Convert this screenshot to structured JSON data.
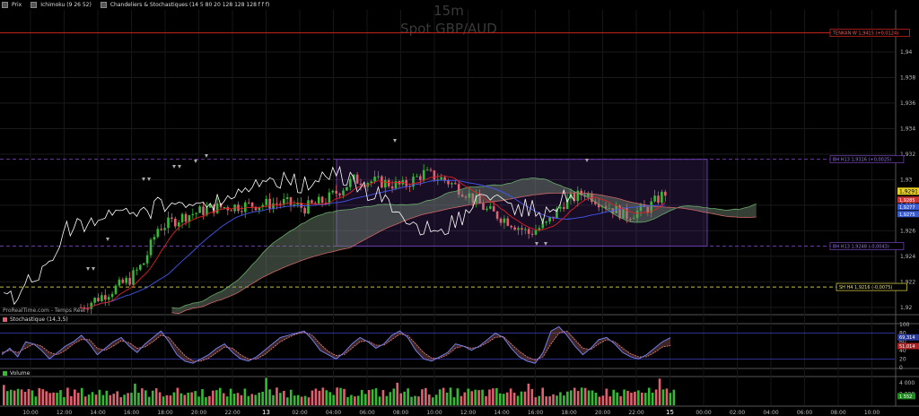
{
  "toolbar": {
    "items": [
      {
        "label": "Prix",
        "icon": "price-icon"
      },
      {
        "label": "Ichimoku (9 26 52)",
        "icon": "ichimoku-icon"
      },
      {
        "label": "Chandeliers & Stochastiques (14 5 80 20 128 128 128 f f f)",
        "icon": "candles-icon"
      }
    ]
  },
  "watermark": {
    "timeframe": "15m",
    "instrument": "Spot GBP/AUD"
  },
  "credit": "ProRealTime.com - Temps Réel",
  "price_axis": {
    "ticks": [
      "1,94",
      "1,938",
      "1,936",
      "1,934",
      "1,932",
      "1,93",
      "1,928",
      "1,926",
      "1,924",
      "1,922",
      "1,92"
    ],
    "current_price": "1,9291",
    "badges": [
      "1,9285",
      "1,9277",
      "1,9275"
    ]
  },
  "levels": [
    {
      "label": "TENKAN W 1,9415 (+0,0124)",
      "value": 1.9415,
      "color": "#cc2222"
    },
    {
      "label": "BH H13 1,9316 (+0,0025)",
      "value": 1.9316,
      "color": "#6a3aa8"
    },
    {
      "label": "BH H13 1,9248 (-0,0043)",
      "value": 1.9248,
      "color": "#6a3aa8"
    },
    {
      "label": "SH H4 1,9216 (-0,0075)",
      "value": 1.9216,
      "color": "#c8c040"
    }
  ],
  "stochastic": {
    "title": "Stochastique (14,3,5)",
    "ticks": [
      "100",
      "80",
      "60",
      "40",
      "20",
      "0"
    ],
    "values_shown": [
      "69,314",
      "51,014"
    ],
    "overbought": 80,
    "oversold": 20,
    "k": [
      30,
      45,
      25,
      60,
      55,
      40,
      20,
      35,
      50,
      60,
      75,
      55,
      30,
      45,
      60,
      70,
      50,
      35,
      55,
      70,
      85,
      60,
      30,
      15,
      10,
      20,
      30,
      45,
      55,
      35,
      20,
      15,
      25,
      40,
      55,
      70,
      75,
      80,
      85,
      65,
      40,
      30,
      20,
      35,
      55,
      70,
      60,
      45,
      55,
      75,
      85,
      70,
      40,
      20,
      15,
      25,
      35,
      55,
      50,
      40,
      50,
      65,
      80,
      70,
      45,
      25,
      15,
      10,
      35,
      85,
      95,
      75,
      50,
      30,
      45,
      65,
      70,
      55,
      35,
      25,
      20,
      30,
      45,
      60,
      69.3
    ],
    "d": [
      35,
      40,
      35,
      45,
      55,
      50,
      35,
      30,
      40,
      55,
      65,
      65,
      45,
      40,
      50,
      62,
      58,
      45,
      48,
      60,
      75,
      70,
      48,
      28,
      15,
      15,
      22,
      35,
      48,
      45,
      30,
      20,
      20,
      30,
      45,
      60,
      70,
      78,
      82,
      75,
      55,
      38,
      28,
      30,
      45,
      60,
      62,
      52,
      52,
      65,
      78,
      75,
      55,
      35,
      22,
      22,
      30,
      45,
      50,
      45,
      48,
      58,
      70,
      72,
      55,
      38,
      25,
      18,
      25,
      55,
      80,
      85,
      65,
      45,
      42,
      55,
      65,
      60,
      45,
      32,
      25,
      25,
      35,
      48,
      51
    ]
  },
  "volume": {
    "title": "Volume",
    "ticks": [
      "4 000",
      "2 000"
    ],
    "values_shown": [
      "1 552"
    ]
  },
  "time_axis": {
    "labels": [
      "10:00",
      "12:00",
      "14:00",
      "16:00",
      "18:00",
      "20:00",
      "22:00",
      "13",
      "02:00",
      "04:00",
      "06:00",
      "08:00",
      "10:00",
      "12:00",
      "14:00",
      "16:00",
      "18:00",
      "20:00",
      "22:00",
      "15",
      "00:00",
      "02:00",
      "04:00",
      "06:00",
      "08:00",
      "10:00"
    ]
  },
  "colors": {
    "bull": "#33bb33",
    "bear": "#e06070",
    "tenkan": "#dd2222",
    "kijun": "#4455ee",
    "chikou": "#ffffff",
    "cloud_bull": "#557755",
    "cloud_bear": "#886666",
    "range_box": "#6a3aa8"
  }
}
